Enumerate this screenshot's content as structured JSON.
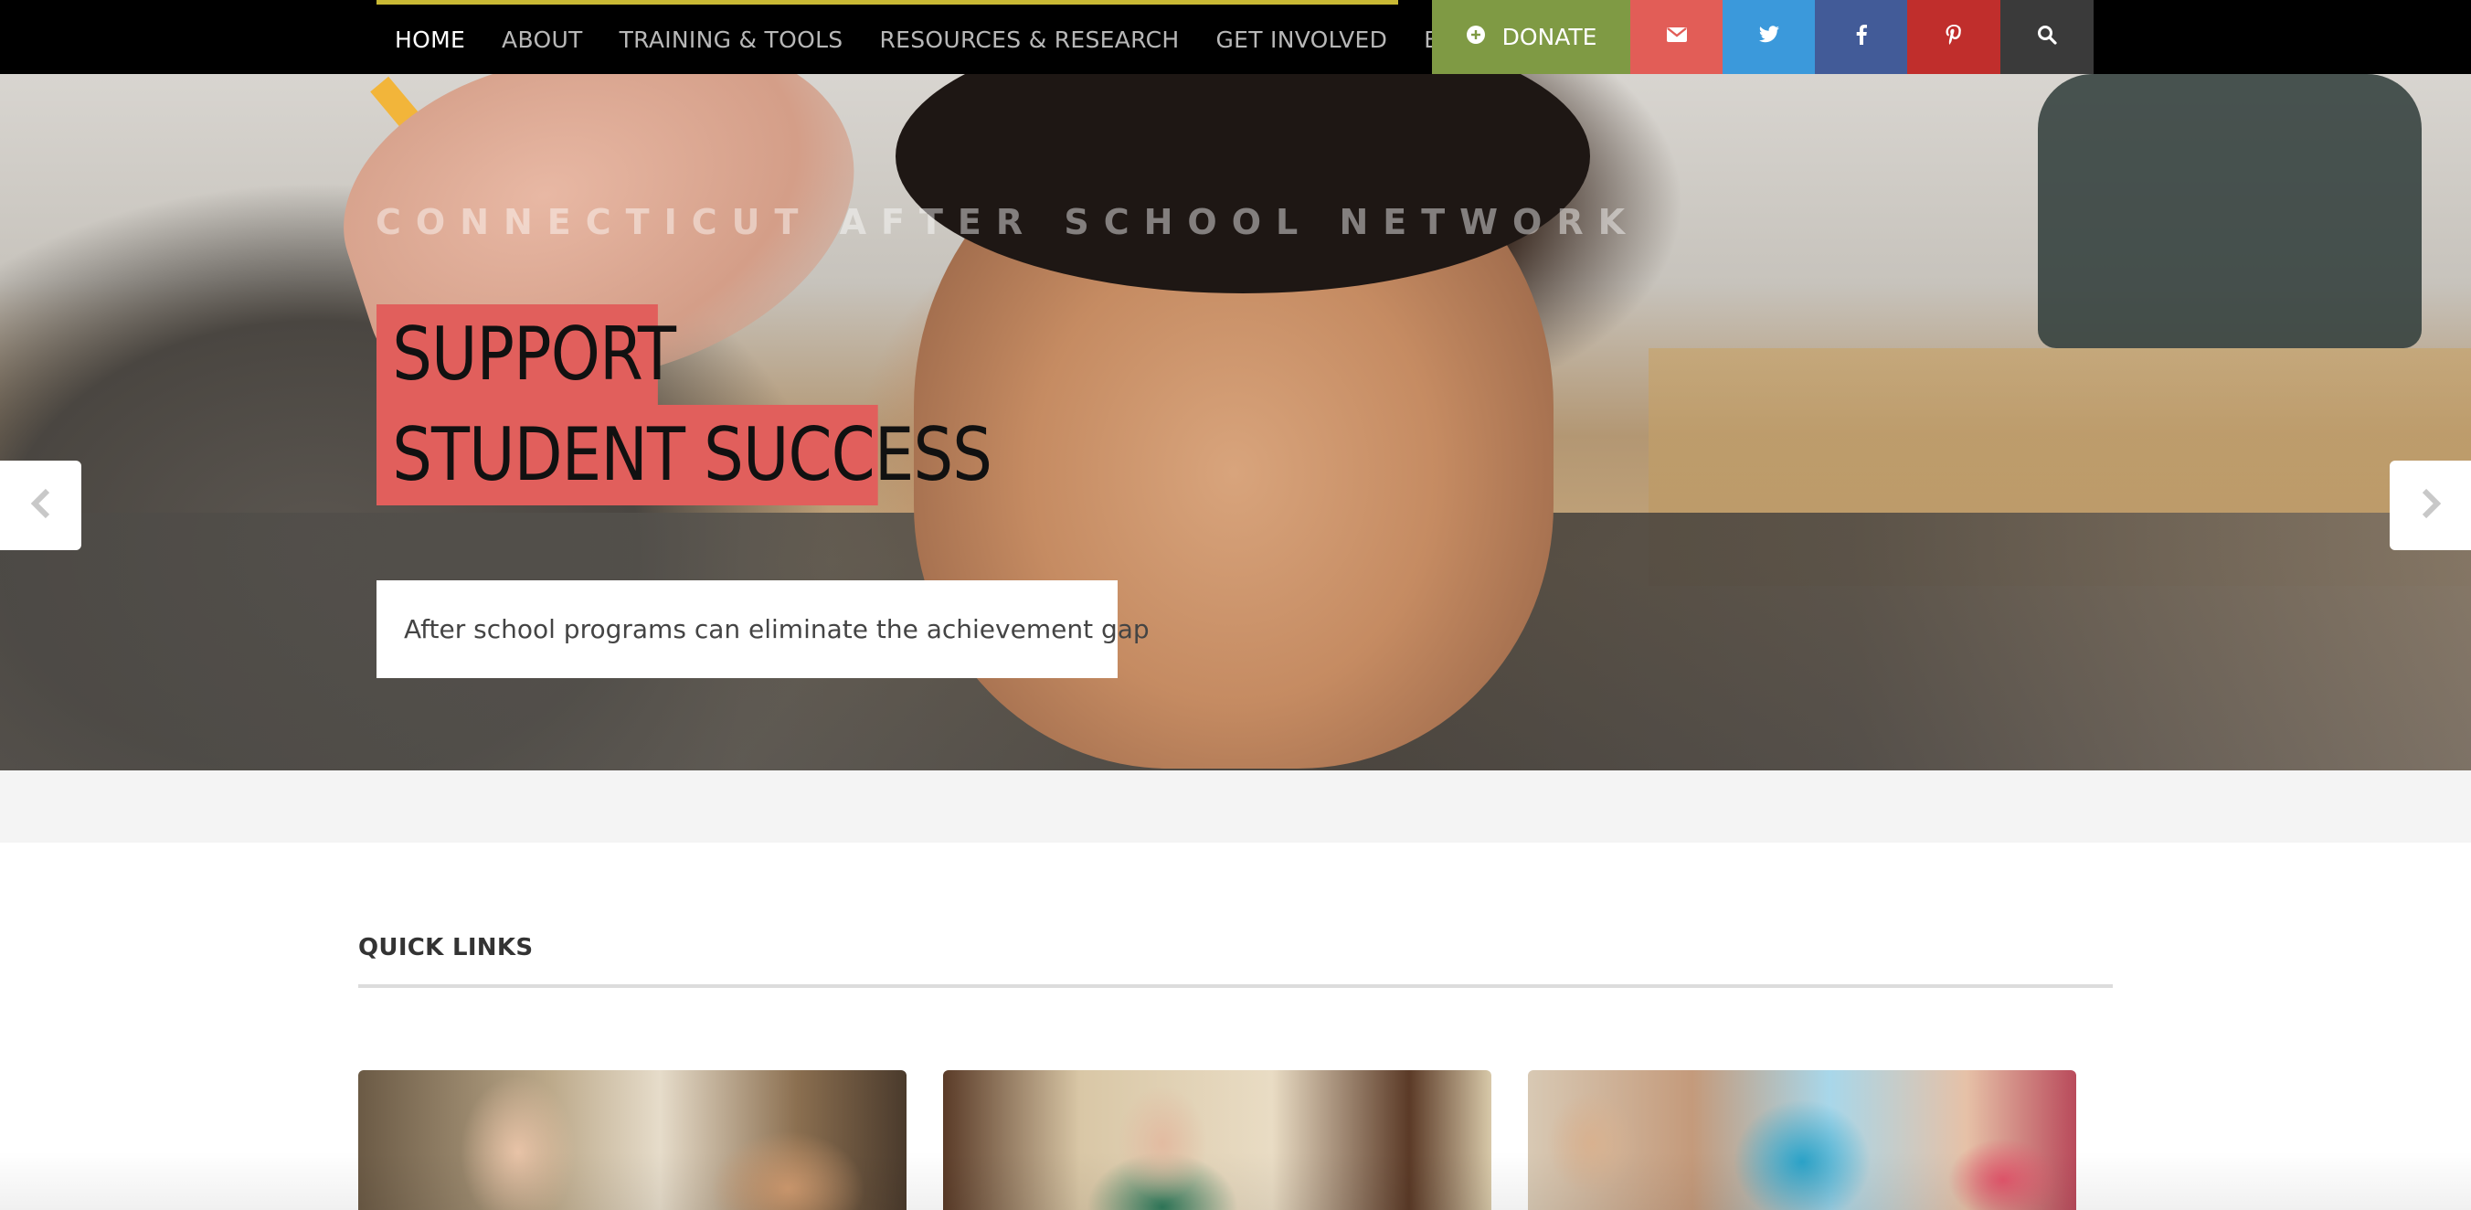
{
  "nav": {
    "items": [
      {
        "label": "HOME",
        "active": true
      },
      {
        "label": "ABOUT"
      },
      {
        "label": "TRAINING & TOOLS"
      },
      {
        "label": "RESOURCES & RESEARCH"
      },
      {
        "label": "GET INVOLVED"
      },
      {
        "label": "BLOG"
      }
    ],
    "accent_color": "#c9b934"
  },
  "actions": {
    "donate_label": "DONATE",
    "donate_color": "#7f9a44",
    "email_color": "#e25d57",
    "twitter_color": "#3b99db",
    "facebook_color": "#425b98",
    "pinterest_color": "#c02e2c",
    "search_color": "#3a3a3a",
    "icons": [
      "plus-circle-icon",
      "email-icon",
      "twitter-icon",
      "facebook-icon",
      "pinterest-icon",
      "search-icon"
    ]
  },
  "hero": {
    "brand": "CONNECTICUT AFTER SCHOOL NETWORK",
    "headline_line1": "SUPPORT",
    "headline_line2": "STUDENT SUCCESS",
    "subtitle": "After school programs can eliminate the achievement gap",
    "headline_color": "#e15f5c"
  },
  "quick_links": {
    "title": "QUICK LINKS",
    "cards": [
      {
        "image": "photo-presentation-meeting"
      },
      {
        "image": "photo-smiling-woman"
      },
      {
        "image": "photo-children-activity"
      }
    ]
  }
}
